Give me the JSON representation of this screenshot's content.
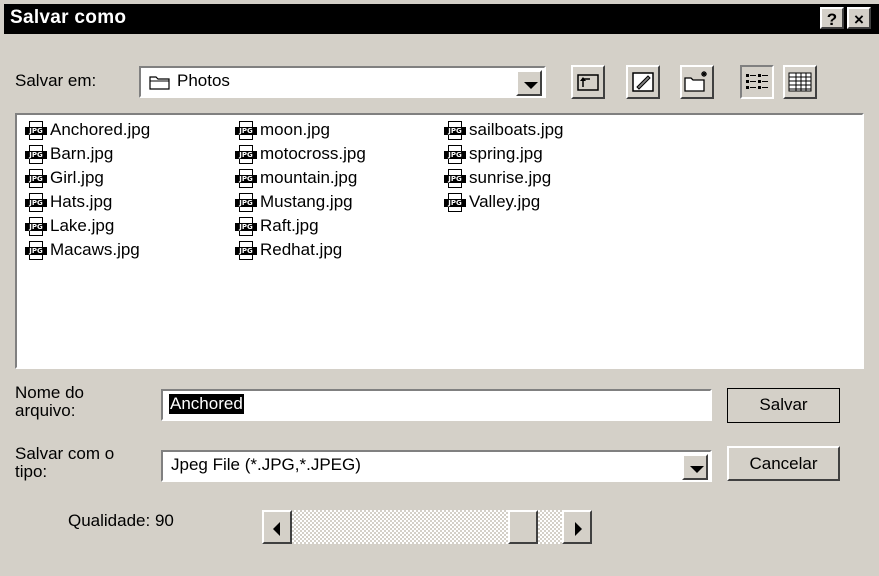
{
  "window": {
    "title": "Salvar como",
    "help_button": "?",
    "close_button": "×"
  },
  "save_in": {
    "label": "Salvar em:",
    "value": "Photos"
  },
  "toolbar": {
    "icons": [
      "up-one-level-icon",
      "desktop-icon",
      "new-folder-icon",
      "list-view-icon",
      "details-view-icon"
    ]
  },
  "files": {
    "columns": [
      [
        "Anchored.jpg",
        "Barn.jpg",
        "Girl.jpg",
        "Hats.jpg",
        "Lake.jpg",
        "Macaws.jpg"
      ],
      [
        "moon.jpg",
        "motocross.jpg",
        "mountain.jpg",
        "Mustang.jpg",
        "Raft.jpg",
        "Redhat.jpg"
      ],
      [
        "sailboats.jpg",
        "spring.jpg",
        "sunrise.jpg",
        "Valley.jpg"
      ]
    ],
    "icon_tag": "JPG"
  },
  "filename": {
    "label_line1": "Nome do",
    "label_line2": "arquivo:",
    "value": "Anchored"
  },
  "filetype": {
    "label_line1": "Salvar com o",
    "label_line2": "tipo:",
    "value": "Jpeg File (*.JPG,*.JPEG)"
  },
  "quality": {
    "label": "Qualidade: 90",
    "value": 90
  },
  "buttons": {
    "save": "Salvar",
    "cancel": "Cancelar"
  }
}
